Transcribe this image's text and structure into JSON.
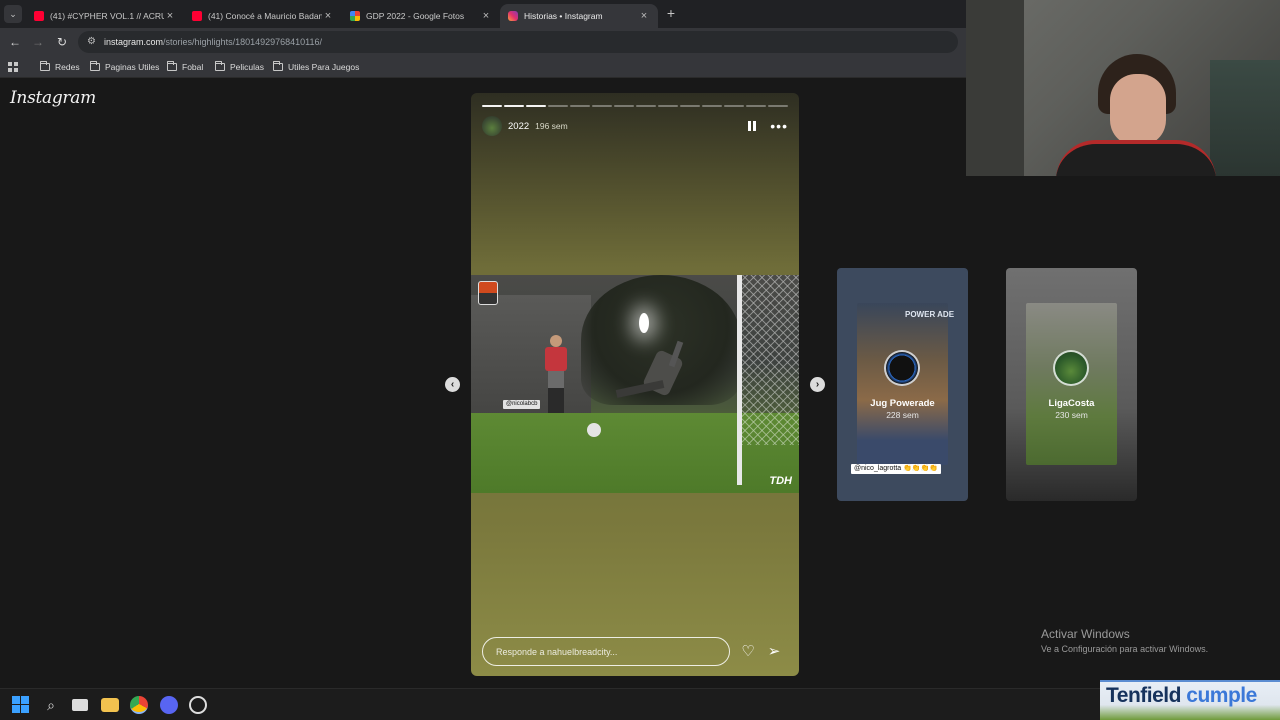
{
  "browser": {
    "tabs": [
      {
        "title": "(41) #CYPHER VOL.1 // ACRU S...",
        "favicon_color": "#ff0033",
        "active": false
      },
      {
        "title": "(41) Conocé a Mauricio Badano",
        "favicon_color": "#ff0033",
        "active": false
      },
      {
        "title": "GDP 2022 - Google Fotos",
        "favicon_color": "#34a853",
        "active": false
      },
      {
        "title": "Historias • Instagram",
        "favicon_color": "#e1306c",
        "active": true
      }
    ],
    "url": {
      "host": "instagram.com",
      "path": "/stories/highlights/18014929768410116/"
    },
    "bookmarks": [
      "Redes",
      "Paginas Utiles",
      "Fobal",
      "Peliculas",
      "Utiles Para Juegos"
    ]
  },
  "instagram": {
    "logo": "Instagram",
    "story": {
      "username": "2022",
      "time": "196 sem",
      "segments_total": 14,
      "segments_done": 3,
      "photo_tag": "@nicolabcb",
      "photo_watermark": "TDH",
      "reply_placeholder": "Responde a nahuelbreadcity...",
      "icons": {
        "pause": "pause-icon",
        "more": "more-icon",
        "like": "heart-icon",
        "share": "send-icon"
      }
    },
    "previews": [
      {
        "name": "Jug Powerade",
        "time": "228 sem",
        "tag_text": "@nico_lagrotta 👏👏👏👏",
        "brand": "POWER ADE"
      },
      {
        "name": "LigaCosta",
        "time": "230 sem"
      }
    ]
  },
  "windows_notice": {
    "title": "Activar Windows",
    "subtitle": "Ve a Configuración para activar Windows."
  },
  "overlay": {
    "brand_left": "Tenfield",
    "brand_right": "cumple"
  }
}
